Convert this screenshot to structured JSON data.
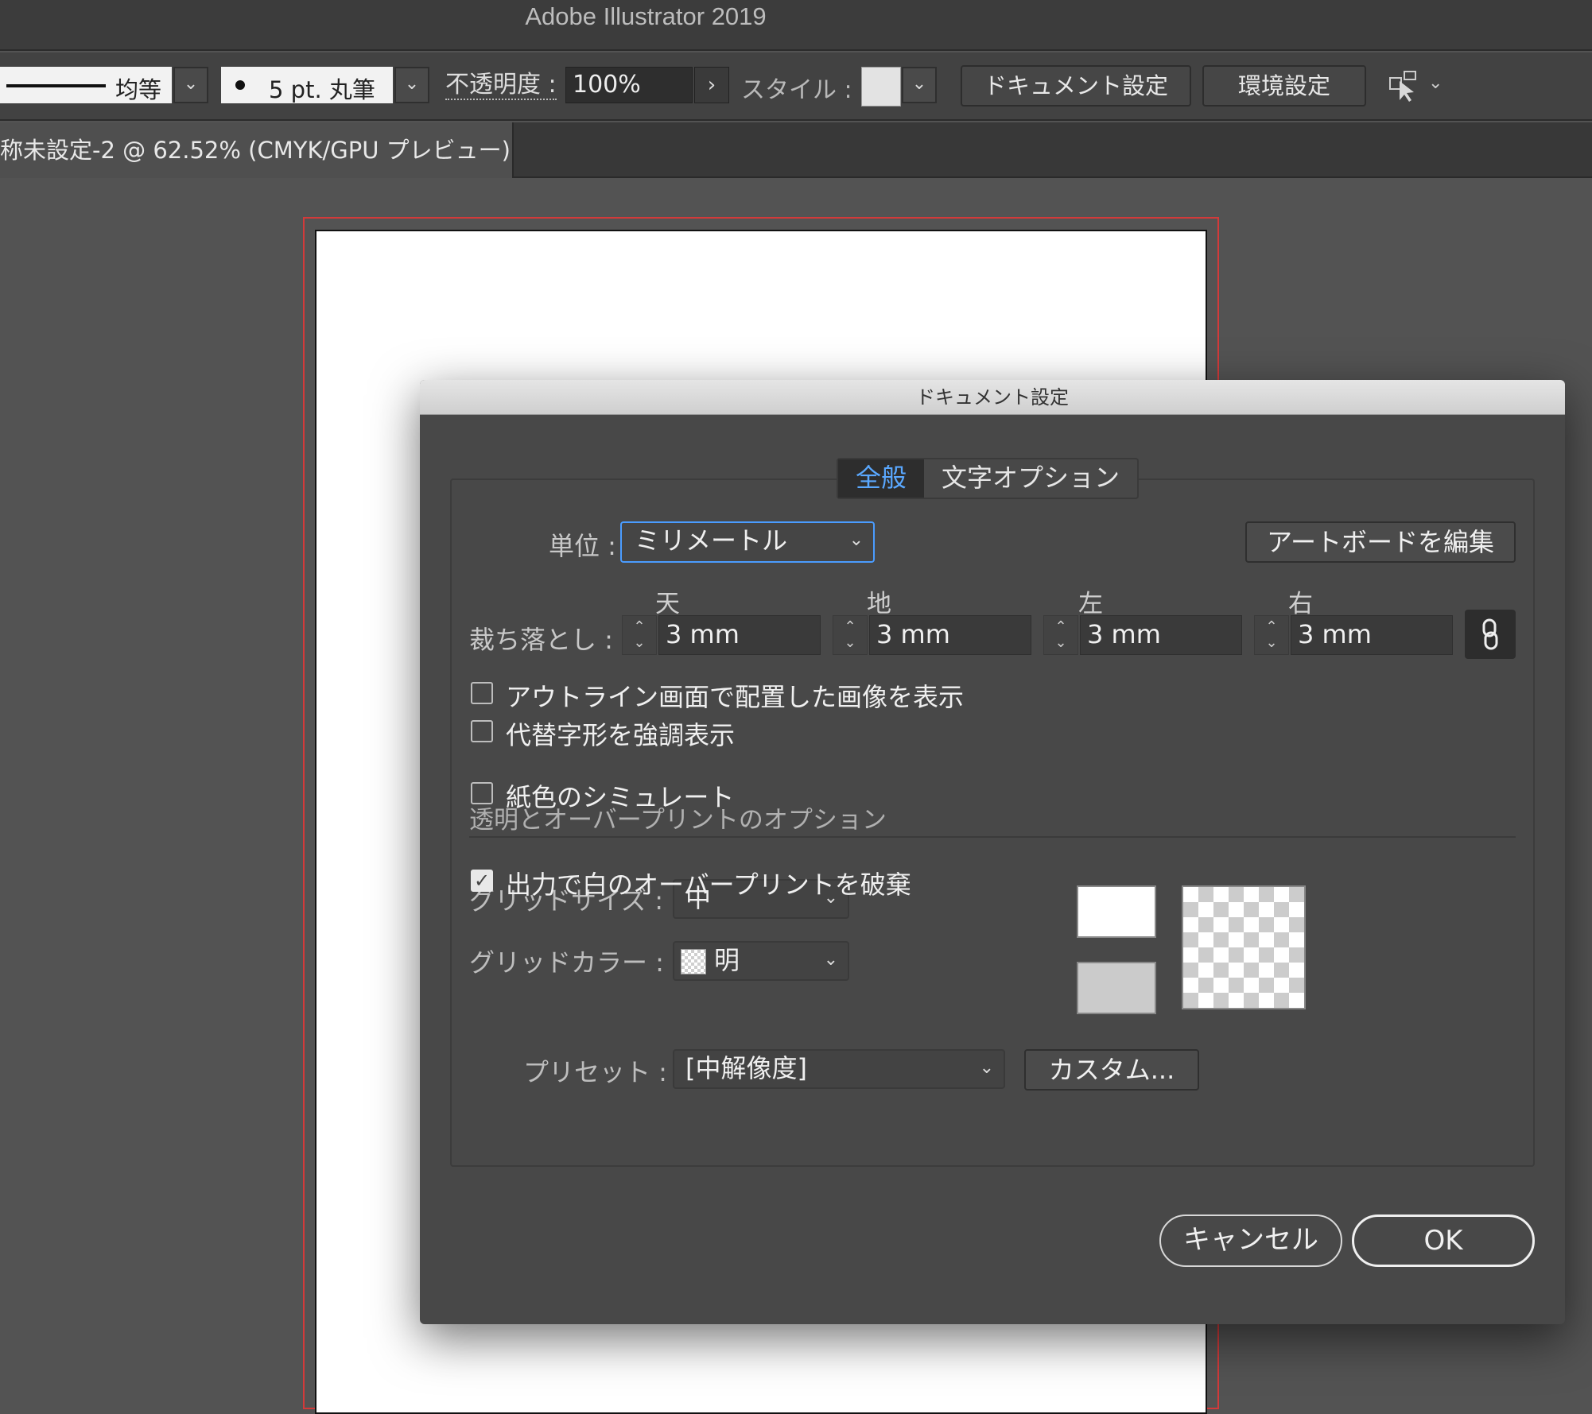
{
  "app": {
    "title": "Adobe Illustrator 2019"
  },
  "control_bar": {
    "stroke_profile": "均等",
    "brush": "5 pt. 丸筆",
    "opacity_label": "不透明度 :",
    "opacity_value": "100%",
    "style_label": "スタイル :",
    "doc_setup_button": "ドキュメント設定",
    "preferences_button": "環境設定",
    "chevron": "⌄",
    "arrow_right": "›"
  },
  "document_tab": {
    "label": "称未設定-2 @ 62.52% (CMYK/GPU プレビュー)"
  },
  "dialog": {
    "title": "ドキュメント設定",
    "tabs": [
      {
        "label": "全般",
        "active": true
      },
      {
        "label": "文字オプション",
        "active": false
      }
    ],
    "units_label": "単位 :",
    "units_value": "ミリメートル",
    "edit_artboards_button": "アートボードを編集",
    "bleed_label": "裁ち落とし :",
    "bleed": [
      {
        "label": "天",
        "value": "3 mm"
      },
      {
        "label": "地",
        "value": "3 mm"
      },
      {
        "label": "左",
        "value": "3 mm"
      },
      {
        "label": "右",
        "value": "3 mm"
      }
    ],
    "link_icon": "chain-link-icon",
    "checkbox_outline_images": {
      "label": "アウトライン画面で配置した画像を表示",
      "checked": false
    },
    "checkbox_highlight_glyphs": {
      "label": "代替字形を強調表示",
      "checked": false
    },
    "transparency_section_title": "透明とオーバープリントのオプション",
    "grid_size_label": "グリッドサイズ :",
    "grid_size_value": "中",
    "grid_color_label": "グリッドカラー :",
    "grid_color_value": "明",
    "checkbox_simulate_paper": {
      "label": "紙色のシミュレート",
      "checked": false
    },
    "preset_label": "プリセット :",
    "preset_value": "[中解像度]",
    "custom_button": "カスタム...",
    "checkbox_discard_white_overprint": {
      "label": "出力で白のオーバープリントを破棄",
      "checked": true
    },
    "cancel_button": "キャンセル",
    "ok_button": "OK"
  },
  "colors": {
    "workspace": "#535353",
    "dialog": "#484848",
    "accent": "#4a9cff",
    "bleed_guide": "#d23a3a"
  }
}
